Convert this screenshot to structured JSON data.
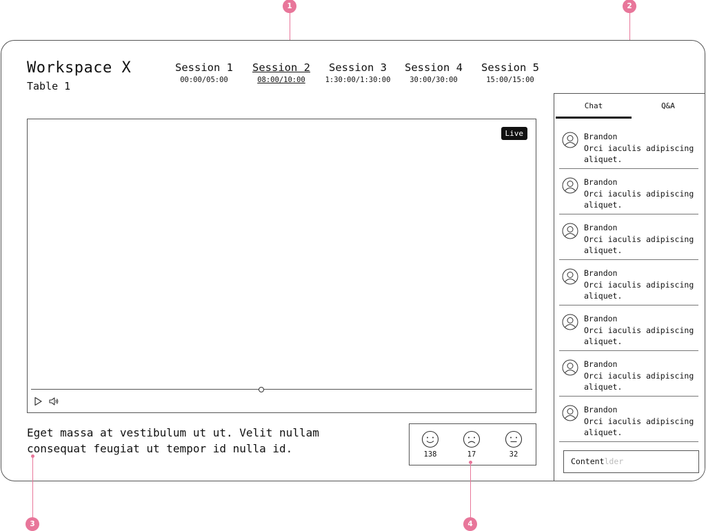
{
  "header": {
    "title": "Workspace X",
    "subtitle": "Table 1"
  },
  "sessions": [
    {
      "name": "Session 1",
      "time": "00:00/05:00",
      "active": false
    },
    {
      "name": "Session 2",
      "time": "08:00/10:00",
      "active": true
    },
    {
      "name": "Session 3",
      "time": "1:30:00/1:30:00",
      "active": false
    },
    {
      "name": "Session 4",
      "time": "30:00/30:00",
      "active": false
    },
    {
      "name": "Session 5",
      "time": "15:00/15:00",
      "active": false
    }
  ],
  "video": {
    "live_label": "Live",
    "progress_fraction": 0.46
  },
  "description": "Eget massa at vestibulum ut ut. Velit nullam consequat feugiat ut tempor id nulla id.",
  "reactions": [
    {
      "icon": "happy-face-icon",
      "count": "138"
    },
    {
      "icon": "sad-face-icon",
      "count": "17"
    },
    {
      "icon": "neutral-face-icon",
      "count": "32"
    }
  ],
  "sidebar": {
    "tabs": {
      "chat": "Chat",
      "qa": "Q&A"
    },
    "messages": [
      {
        "author": "Brandon",
        "text": "Orci iaculis adipiscing aliquet."
      },
      {
        "author": "Brandon",
        "text": "Orci iaculis adipiscing aliquet."
      },
      {
        "author": "Brandon",
        "text": "Orci iaculis adipiscing aliquet."
      },
      {
        "author": "Brandon",
        "text": "Orci iaculis adipiscing aliquet."
      },
      {
        "author": "Brandon",
        "text": "Orci iaculis adipiscing aliquet."
      },
      {
        "author": "Brandon",
        "text": "Orci iaculis adipiscing aliquet."
      },
      {
        "author": "Brandon",
        "text": "Orci iaculis adipiscing aliquet."
      }
    ],
    "input": {
      "value": "Content",
      "ghost": "lder"
    }
  },
  "annotations": [
    "1",
    "2",
    "3",
    "4"
  ],
  "colors": {
    "annotation": "#e8769a",
    "live_badge": "#111111"
  }
}
